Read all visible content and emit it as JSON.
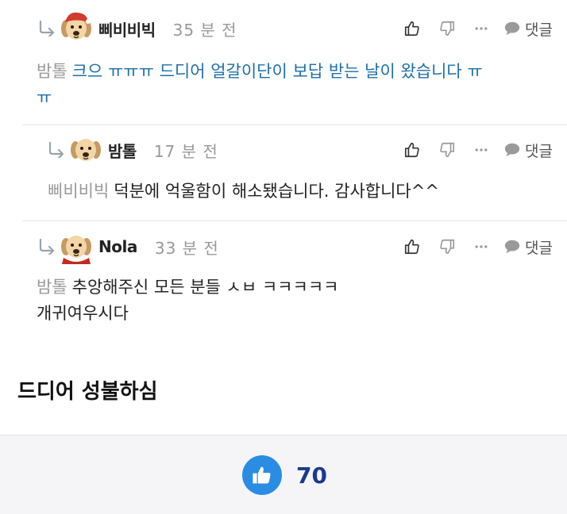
{
  "comments": [
    {
      "author": "삐비비빅",
      "time": "35 분 전",
      "mention": "밤톨",
      "text": "크으 ㅠㅠㅠ 드디어 얼갈이단이 보답 받는 날이 왔습니다 ㅠ",
      "text2": "ㅠ",
      "reply_label": "댓글",
      "avatar_icon": "puppy-red-hat-avatar"
    },
    {
      "author": "밤톨",
      "time": "17 분 전",
      "mention": "삐비비빅",
      "text": "덕분에 억울함이 해소됐습니다. 감사합니다^^",
      "reply_label": "댓글",
      "avatar_icon": "puppy-avatar"
    },
    {
      "author": "Nola",
      "time": "33 분 전",
      "mention": "밤톨",
      "text": "추앙해주신 모든 분들 ㅅㅂ ㅋㅋㅋㅋㅋ",
      "text2": "개귀여우시다",
      "reply_label": "댓글",
      "avatar_icon": "puppy-red-cape-avatar"
    }
  ],
  "post_text": "드디어 성불하심",
  "like": {
    "count": "70"
  },
  "colors": {
    "mention_gray": "#999999",
    "highlight_blue": "#1d6fa8",
    "like_blue": "#2a8de3",
    "like_count": "#1b3a8c"
  }
}
